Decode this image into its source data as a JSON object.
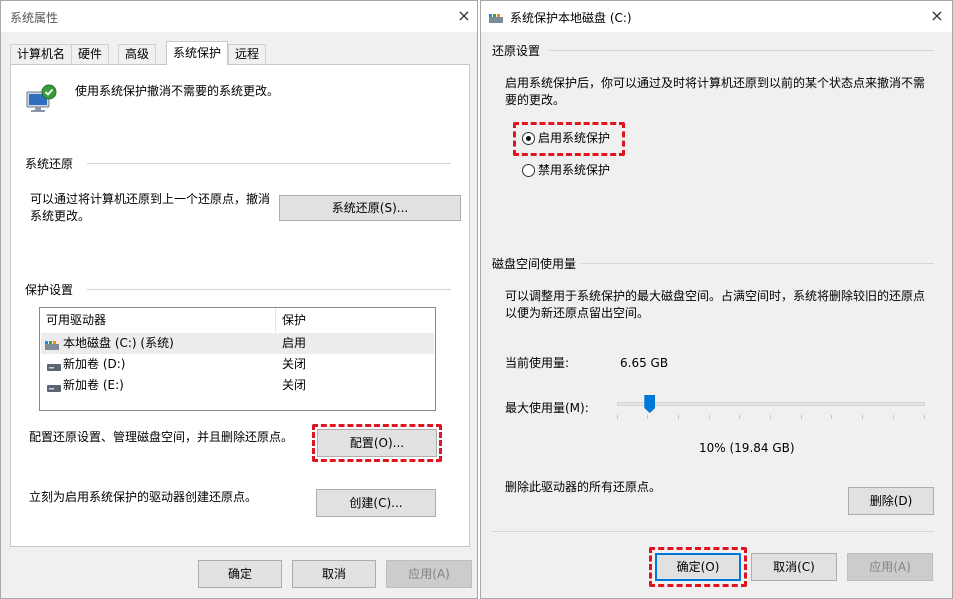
{
  "left_window": {
    "title": "系统属性",
    "close_glyph": "×",
    "tabs": [
      {
        "label": "计算机名",
        "active": false
      },
      {
        "label": "硬件",
        "active": false
      },
      {
        "label": "高级",
        "active": false
      },
      {
        "label": "系统保护",
        "active": true
      },
      {
        "label": "远程",
        "active": false
      }
    ],
    "intro_text": "使用系统保护撤消不需要的系统更改。",
    "intro_icon": "computer-shield-icon",
    "system_restore": {
      "section_label": "系统还原",
      "description": "可以通过将计算机还原到上一个还原点，撤消系统更改。",
      "button_label": "系统还原(S)..."
    },
    "protection": {
      "section_label": "保护设置",
      "columns": [
        "可用驱动器",
        "保护"
      ],
      "drives": [
        {
          "name": "本地磁盘 (C:) (系统)",
          "status": "启用",
          "icon": "system-drive-icon",
          "selected": true
        },
        {
          "name": "新加卷 (D:)",
          "status": "关闭",
          "icon": "drive-icon",
          "selected": false
        },
        {
          "name": "新加卷 (E:)",
          "status": "关闭",
          "icon": "drive-icon",
          "selected": false
        }
      ],
      "configure_text": "配置还原设置、管理磁盘空间，并且删除还原点。",
      "configure_button": "配置(O)...",
      "create_text": "立刻为启用系统保护的驱动器创建还原点。",
      "create_button": "创建(C)..."
    },
    "footer": {
      "ok": "确定",
      "cancel": "取消",
      "apply": "应用(A)"
    }
  },
  "right_window": {
    "title": "系统保护本地磁盘 (C:)",
    "close_glyph": "×",
    "restore_settings": {
      "section_label": "还原设置",
      "description": "启用系统保护后，你可以通过及时将计算机还原到以前的某个状态点来撤消不需要的更改。",
      "options": [
        {
          "label": "启用系统保护",
          "checked": true
        },
        {
          "label": "禁用系统保护",
          "checked": false
        }
      ]
    },
    "disk_usage": {
      "section_label": "磁盘空间使用量",
      "description": "可以调整用于系统保护的最大磁盘空间。占满空间时，系统将删除较旧的还原点以便为新还原点留出空间。",
      "current_label": "当前使用量:",
      "current_value": "6.65 GB",
      "max_label": "最大使用量(M):",
      "slider_fraction": 0.1,
      "max_value": "10% (19.84 GB)",
      "delete_text": "删除此驱动器的所有还原点。",
      "delete_button": "删除(D)"
    },
    "footer": {
      "ok": "确定(O)",
      "cancel": "取消(C)",
      "apply": "应用(A)"
    }
  },
  "colors": {
    "highlight": "#e0141e",
    "accent": "#0078d7"
  }
}
